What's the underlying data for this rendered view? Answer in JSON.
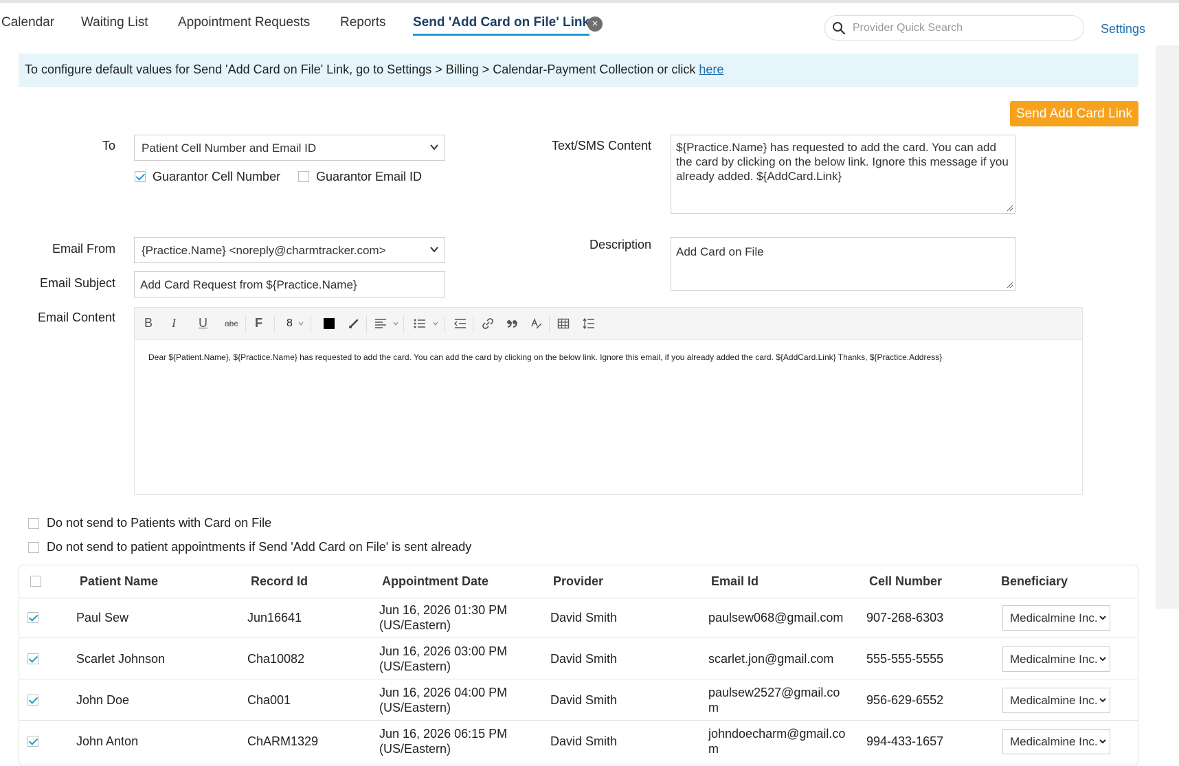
{
  "nav": {
    "tabs": [
      {
        "label": "Calendar"
      },
      {
        "label": "Waiting List"
      },
      {
        "label": "Appointment Requests"
      },
      {
        "label": "Reports"
      },
      {
        "label": "Send 'Add Card on File' Link"
      }
    ],
    "close_symbol": "×",
    "search_placeholder": "Provider Quick Search",
    "settings_label": "Settings"
  },
  "banner": {
    "text": "To configure default values for Send 'Add Card on File' Link, go to Settings > Billing > Calendar-Payment Collection or click ",
    "link_text": "here"
  },
  "send_button_label": "Send Add Card Link",
  "form": {
    "to_label": "To",
    "to_value": "Patient Cell Number and Email ID",
    "guarantor_cell_label": "Guarantor Cell Number",
    "guarantor_cell_checked": true,
    "guarantor_email_label": "Guarantor Email ID",
    "guarantor_email_checked": false,
    "email_from_label": "Email From",
    "email_from_value": "{Practice.Name} <noreply@charmtracker.com>",
    "email_subject_label": "Email Subject",
    "email_subject_value": "Add Card Request from ${Practice.Name}",
    "email_content_label": "Email Content",
    "sms_label": "Text/SMS Content",
    "sms_line1": "${Practice.Name} has requested to add the card. You can add",
    "sms_line2": "the card by clicking on the below link. Ignore this message if you",
    "sms_line3": "already added. ${AddCard.Link}",
    "description_label": "Description",
    "description_value": "Add Card on File"
  },
  "editor": {
    "toolbar": {
      "bold": "B",
      "italic": "I",
      "underline": "U",
      "strike": "abc",
      "font": "F",
      "font_size": "8"
    },
    "body": "Dear ${Patient.Name}, ${Practice.Name} has requested to add the card. You can add the card by clicking on the below link. Ignore this email, if you already added the card. ${AddCard.Link} Thanks, ${Practice.Address}"
  },
  "options": {
    "no_send_card_on_file": "Do not send to Patients with Card on File",
    "no_send_already_sent": "Do not send to patient appointments if Send 'Add Card on File' is sent already"
  },
  "table": {
    "headers": [
      "Patient Name",
      "Record Id",
      "Appointment Date",
      "Provider",
      "Email Id",
      "Cell Number",
      "Beneficiary"
    ],
    "rows": [
      {
        "name": "Paul Sew",
        "record": "Jun16641",
        "date1": "Jun 16, 2026 01:30 PM",
        "date2": "(US/Eastern)",
        "provider": "David Smith",
        "email1": "paulsew068@gmail.com",
        "email2": "",
        "cell": "907-268-6303",
        "beneficiary": "Medicalmine Inc.",
        "checked": true
      },
      {
        "name": "Scarlet Johnson",
        "record": "Cha10082",
        "date1": "Jun 16, 2026 03:00 PM",
        "date2": "(US/Eastern)",
        "provider": "David Smith",
        "email1": "scarlet.jon@gmail.com",
        "email2": "",
        "cell": "555-555-5555",
        "beneficiary": "Medicalmine Inc.",
        "checked": true
      },
      {
        "name": "John Doe",
        "record": "Cha001",
        "date1": "Jun 16, 2026 04:00 PM",
        "date2": "(US/Eastern)",
        "provider": "David Smith",
        "email1": "paulsew2527@gmail.co",
        "email2": "m",
        "cell": "956-629-6552",
        "beneficiary": "Medicalmine Inc.",
        "checked": true
      },
      {
        "name": "John Anton",
        "record": "ChARM1329",
        "date1": "Jun 16, 2026 06:15 PM",
        "date2": "(US/Eastern)",
        "provider": "David Smith",
        "email1": "johndoecharm@gmail.co",
        "email2": "m",
        "cell": "994-433-1657",
        "beneficiary": "Medicalmine Inc.",
        "checked": true
      }
    ]
  },
  "colors": {
    "accent": "#1c9ad6",
    "button": "#f7a21c",
    "banner": "#e6f5fb",
    "link": "#1b6ea8"
  }
}
